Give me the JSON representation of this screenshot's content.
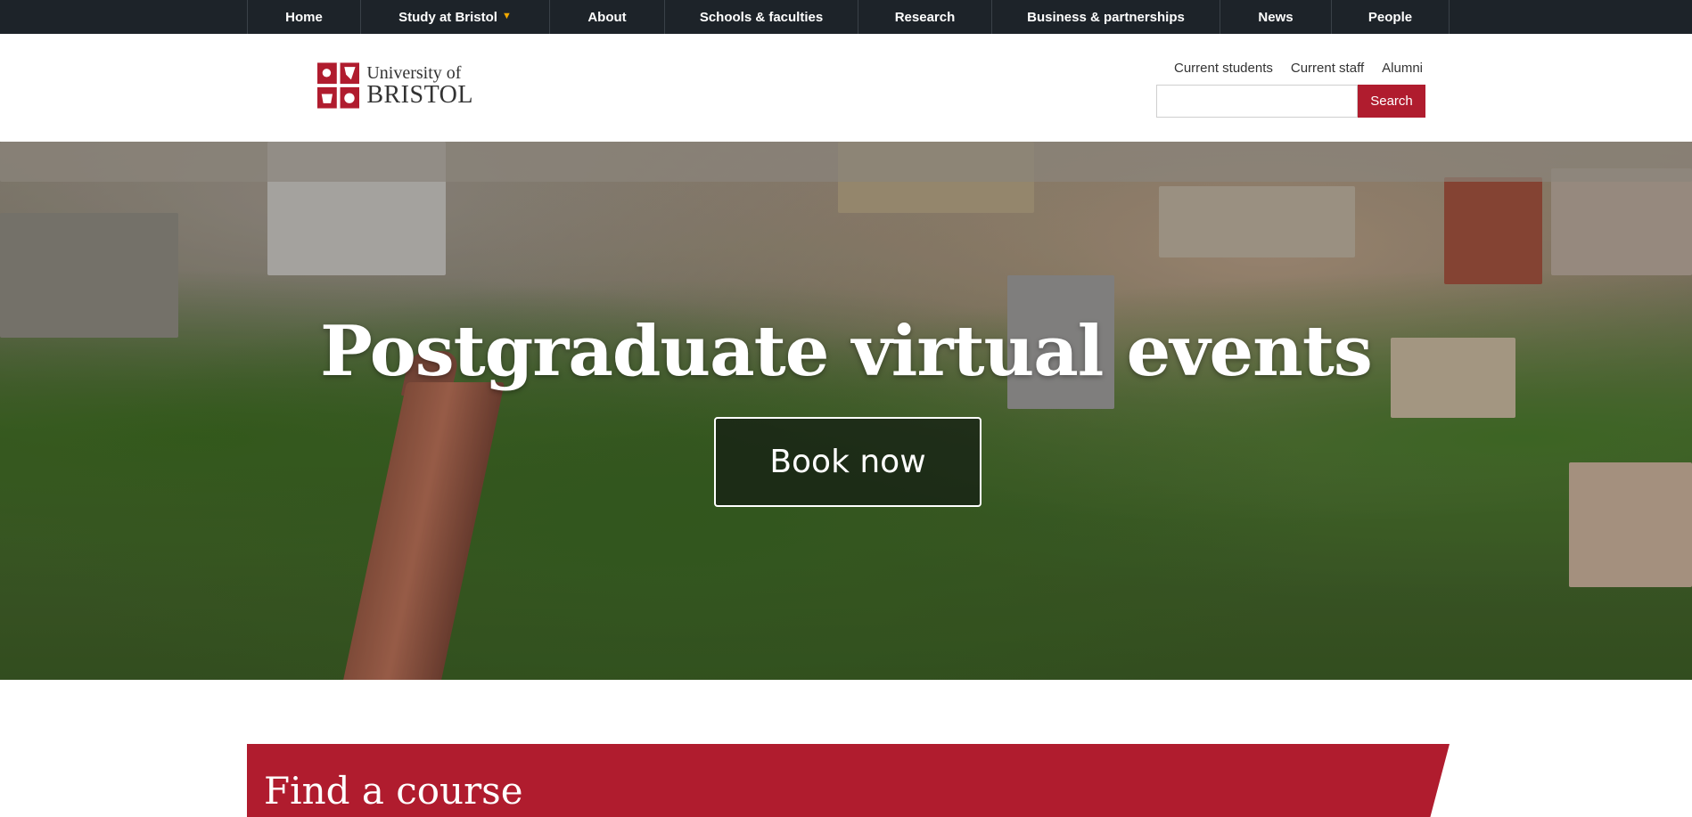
{
  "topnav": {
    "items": [
      {
        "label": "Home"
      },
      {
        "label": "Study at Bristol"
      },
      {
        "label": "About"
      },
      {
        "label": "Schools & faculties"
      },
      {
        "label": "Research"
      },
      {
        "label": "Business & partnerships"
      },
      {
        "label": "News"
      },
      {
        "label": "People"
      }
    ]
  },
  "header": {
    "logo_line1": "University of",
    "logo_line2": "BRISTOL",
    "utility_links": [
      "Current students",
      "Current staff",
      "Alumni"
    ],
    "search": {
      "value": "",
      "button_label": "Search"
    }
  },
  "hero": {
    "title": "Postgraduate virtual events",
    "cta_label": "Book now"
  },
  "find_course": {
    "title": "Find a course"
  },
  "colors": {
    "nav_bg": "#1d2329",
    "brand_red": "#b01c2e",
    "accent": "#f2a900"
  }
}
